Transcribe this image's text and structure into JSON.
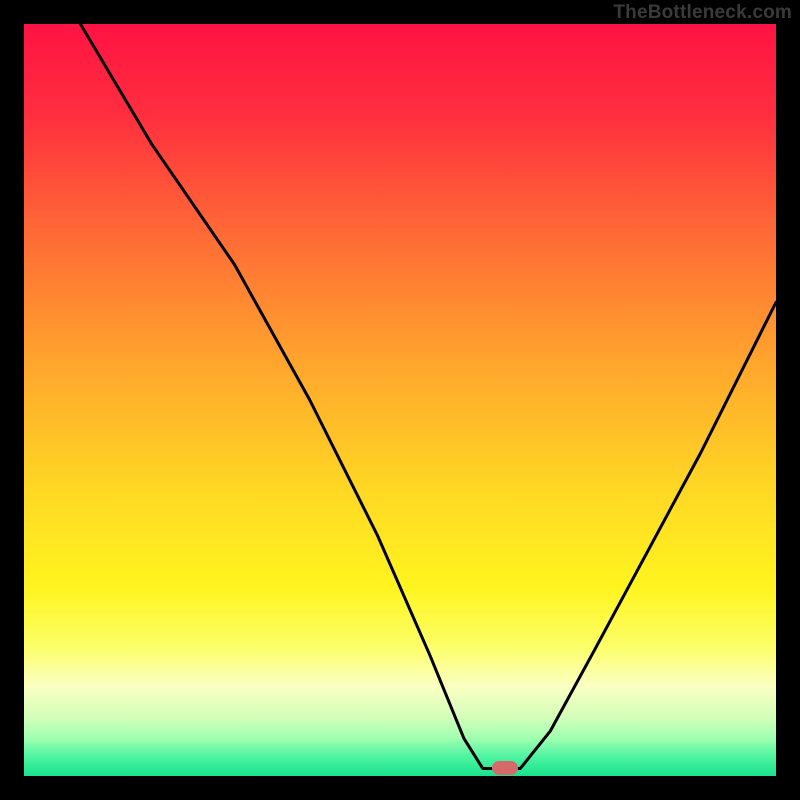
{
  "watermark": {
    "text": "TheBottleneck.com"
  },
  "marker": {
    "x_pct": 64,
    "y_pct": 99,
    "color": "#d66a6a"
  },
  "gradient_stops": [
    {
      "offset": 0,
      "color": "#ff1343"
    },
    {
      "offset": 12,
      "color": "#ff2e3f"
    },
    {
      "offset": 28,
      "color": "#ff6a36"
    },
    {
      "offset": 45,
      "color": "#ffa52d"
    },
    {
      "offset": 62,
      "color": "#ffd824"
    },
    {
      "offset": 75,
      "color": "#fff41f"
    },
    {
      "offset": 83,
      "color": "#fcff6a"
    },
    {
      "offset": 88,
      "color": "#fbffc2"
    },
    {
      "offset": 92,
      "color": "#d6ffba"
    },
    {
      "offset": 95,
      "color": "#9fffb0"
    },
    {
      "offset": 97.5,
      "color": "#4cf3a0"
    },
    {
      "offset": 100,
      "color": "#19e28d"
    }
  ],
  "chart_data": {
    "type": "line",
    "title": "",
    "xlabel": "",
    "ylabel": "",
    "xlim": [
      0,
      100
    ],
    "ylim": [
      0,
      100
    ],
    "series": [
      {
        "name": "bottleneck-curve",
        "points": [
          {
            "x": 7.5,
            "y": 100
          },
          {
            "x": 17,
            "y": 84
          },
          {
            "x": 28,
            "y": 68
          },
          {
            "x": 38,
            "y": 50
          },
          {
            "x": 47,
            "y": 32
          },
          {
            "x": 54,
            "y": 16
          },
          {
            "x": 58.5,
            "y": 5
          },
          {
            "x": 61,
            "y": 1
          },
          {
            "x": 66,
            "y": 1
          },
          {
            "x": 70,
            "y": 6
          },
          {
            "x": 76,
            "y": 17
          },
          {
            "x": 83,
            "y": 30
          },
          {
            "x": 90,
            "y": 43
          },
          {
            "x": 96,
            "y": 55
          },
          {
            "x": 100,
            "y": 63
          }
        ]
      }
    ]
  }
}
